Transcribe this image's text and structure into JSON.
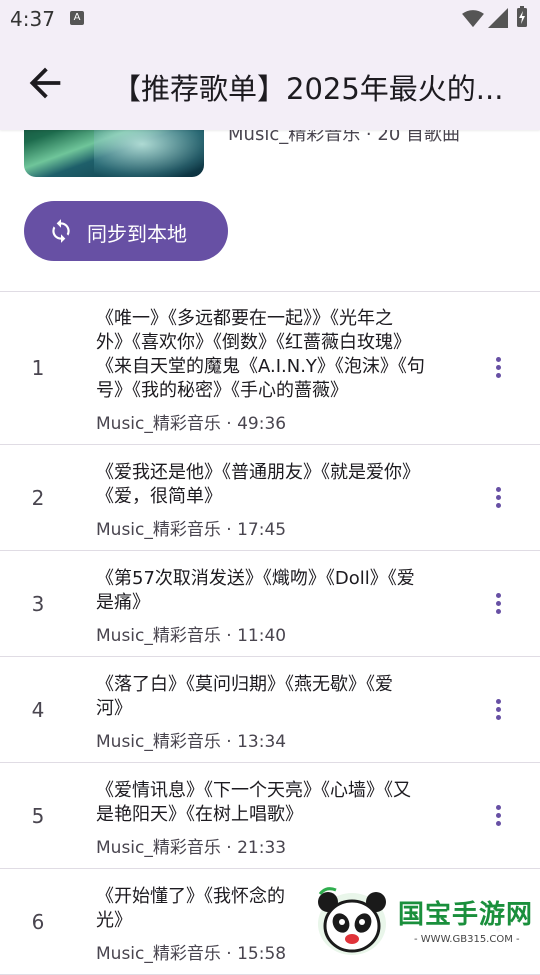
{
  "status_bar": {
    "time": "4:37",
    "app_icon_letter": "A"
  },
  "app_bar": {
    "title": "【推荐歌单】2025年最火的..."
  },
  "header": {
    "meta": "Music_精彩音乐 · 20 首歌曲",
    "sync_button_label": "同步到本地"
  },
  "list": [
    {
      "num": "1",
      "title_lines": [
        "《唯一》《多远都要在一起》》《光年之",
        "外》《喜欢你》《倒数》《红蔷薇白玫瑰》",
        "《来自天堂的魔鬼《A.I.N.Y》《泡沫》《句",
        "号》《我的秘密》《手心的蔷薇》"
      ],
      "sub": "Music_精彩音乐 · 49:36"
    },
    {
      "num": "2",
      "title_lines": [
        "《爱我还是他》《普通朋友》《就是爱你》",
        "《爱，很简单》"
      ],
      "sub": "Music_精彩音乐 · 17:45"
    },
    {
      "num": "3",
      "title_lines": [
        "《第57次取消发送》《熾吻》《Doll》《爱",
        "是痛》"
      ],
      "sub": "Music_精彩音乐 · 11:40"
    },
    {
      "num": "4",
      "title_lines": [
        "《落了白》《莫问归期》《燕无歇》《爱",
        "河》"
      ],
      "sub": "Music_精彩音乐 · 13:34"
    },
    {
      "num": "5",
      "title_lines": [
        "《爱情讯息》《下一个天亮》《心墙》《又",
        "是艳阳天》《在树上唱歌》"
      ],
      "sub": "Music_精彩音乐 · 21:33"
    },
    {
      "num": "6",
      "title_lines": [
        "《开始懂了》《我怀念的",
        "光》"
      ],
      "sub": "Music_精彩音乐 · 15:58"
    }
  ],
  "watermark": {
    "name": "国宝手游网",
    "url": "- WWW.GB315.COM -"
  },
  "colors": {
    "accent": "#6750a4",
    "app_bar_bg": "#f3eef7",
    "divider": "#e0dce4"
  },
  "icons": {
    "back": "arrow-left-icon",
    "sync": "sync-icon",
    "more": "more-vert-icon",
    "wifi": "wifi-icon",
    "signal": "signal-icon",
    "battery": "battery-charging-icon"
  }
}
